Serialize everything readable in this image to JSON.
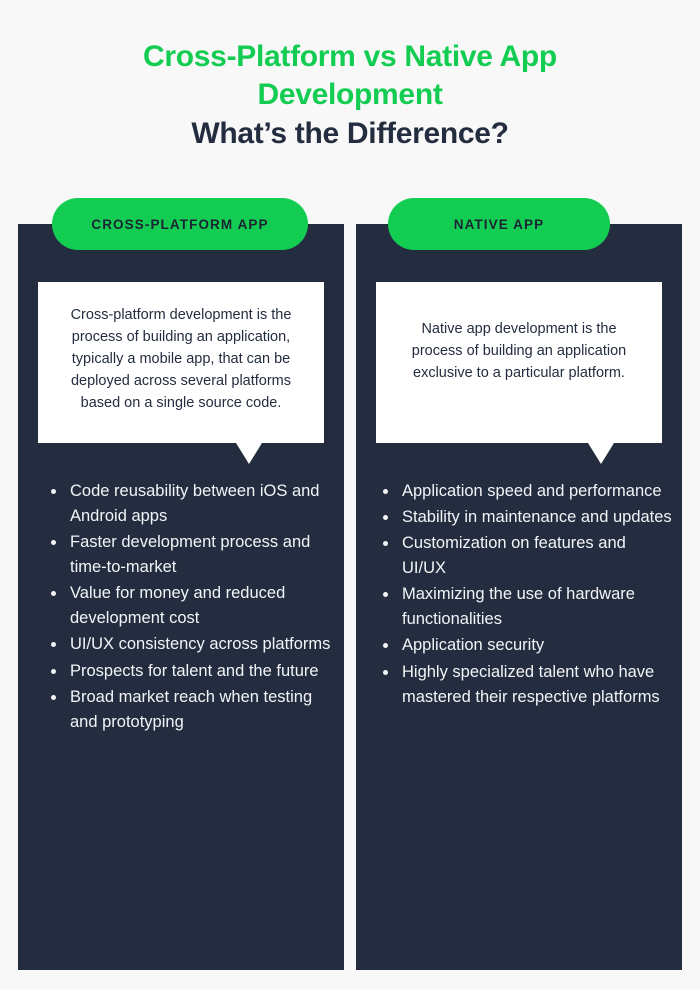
{
  "colors": {
    "background": "#f8f8f8",
    "panel_dark": "#242d3f",
    "accent_green": "#13cd52",
    "bubble_white": "#ffffff",
    "bullet_text": "#f2f4f7"
  },
  "title": {
    "line1": "Cross-Platform vs Native App",
    "line2": "Development",
    "line3": "What’s the Difference?"
  },
  "columns": [
    {
      "pill_label": "CROSS-PLATFORM APP",
      "description": "Cross-platform development is the process of building an application, typically a mobile app, that can be deployed across several platforms based on a single source code.",
      "bullets": [
        "Code reusability between iOS and Android apps",
        "Faster development process and time-to-market",
        "Value for money and reduced development cost",
        "UI/UX consistency across platforms",
        "Prospects for talent and the future",
        "Broad market reach when testing and prototyping"
      ]
    },
    {
      "pill_label": "NATIVE APP",
      "description": "Native app development is the process of building an application exclusive to a particular platform.",
      "bullets": [
        "Application speed and performance",
        "Stability in maintenance and updates",
        "Customization on features and UI/UX",
        "Maximizing the use of hardware functionalities",
        "Application security",
        "Highly specialized talent who have mastered their respective platforms"
      ]
    }
  ]
}
